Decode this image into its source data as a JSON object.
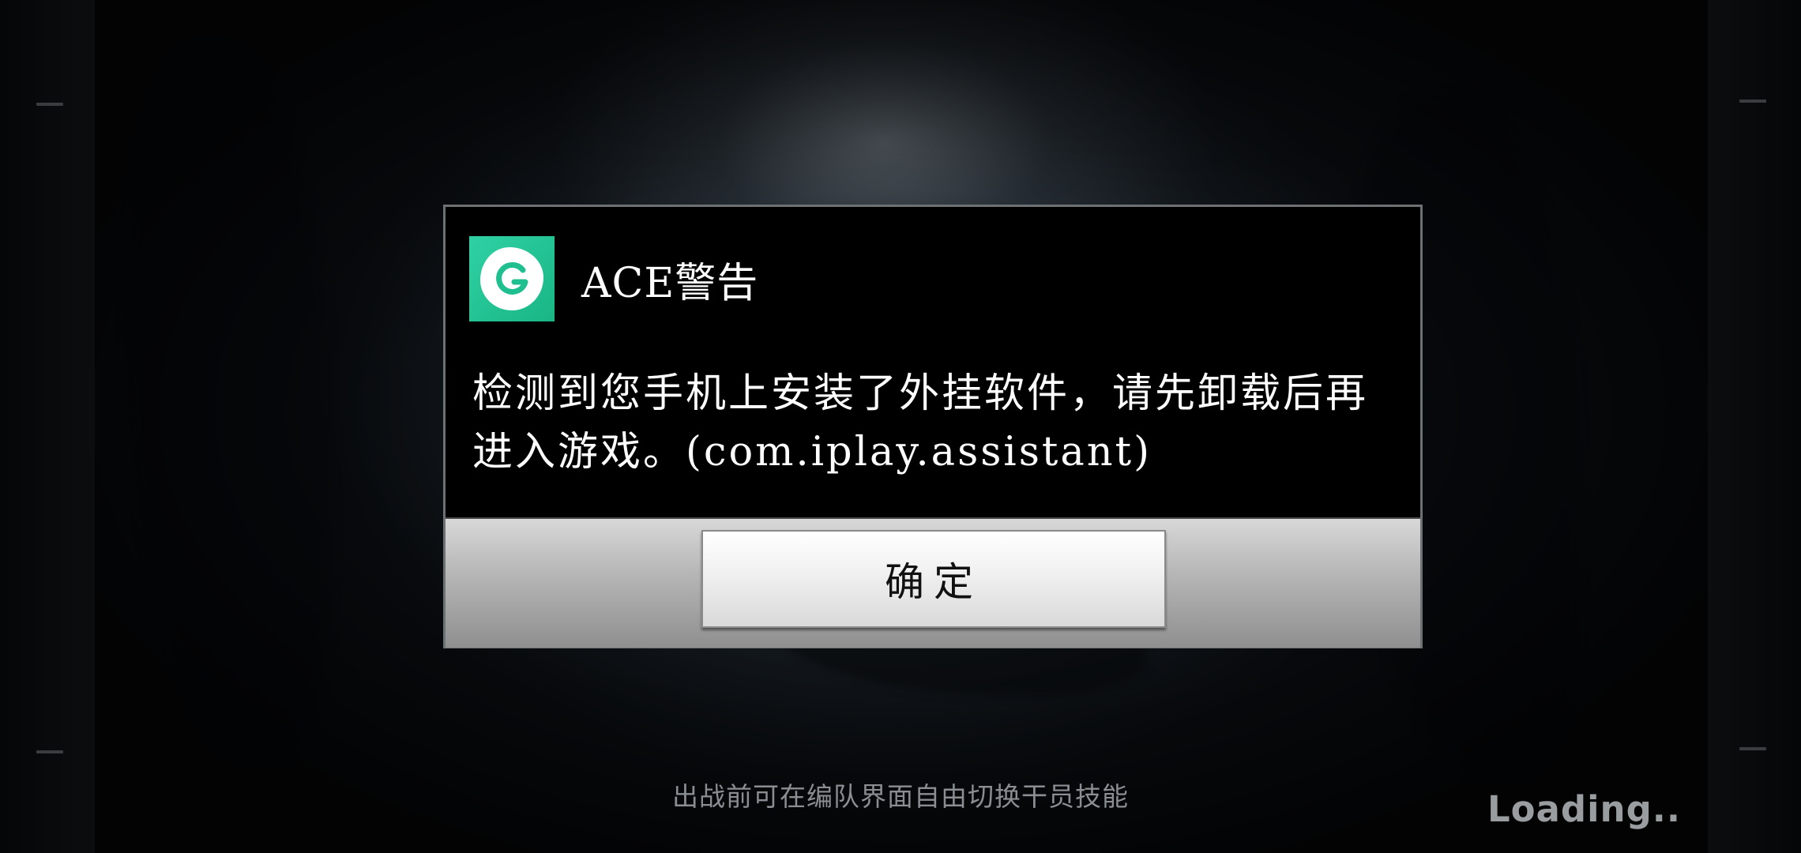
{
  "dialog": {
    "icon": "gamepad-g-logo-icon",
    "title": "ACE警告",
    "message": "检测到您手机上安装了外挂软件，请先卸载后再进入游戏。(com.iplay.assistant)",
    "confirm_label": "确定"
  },
  "game": {
    "tip": "出战前可在编队界面自由切换干员技能",
    "loading": "Loading.."
  },
  "colors": {
    "icon_bg": "#22c394",
    "dialog_bg": "#000000",
    "footer_bg": "#b8b8b8",
    "button_bg": "#f0f0f0"
  }
}
